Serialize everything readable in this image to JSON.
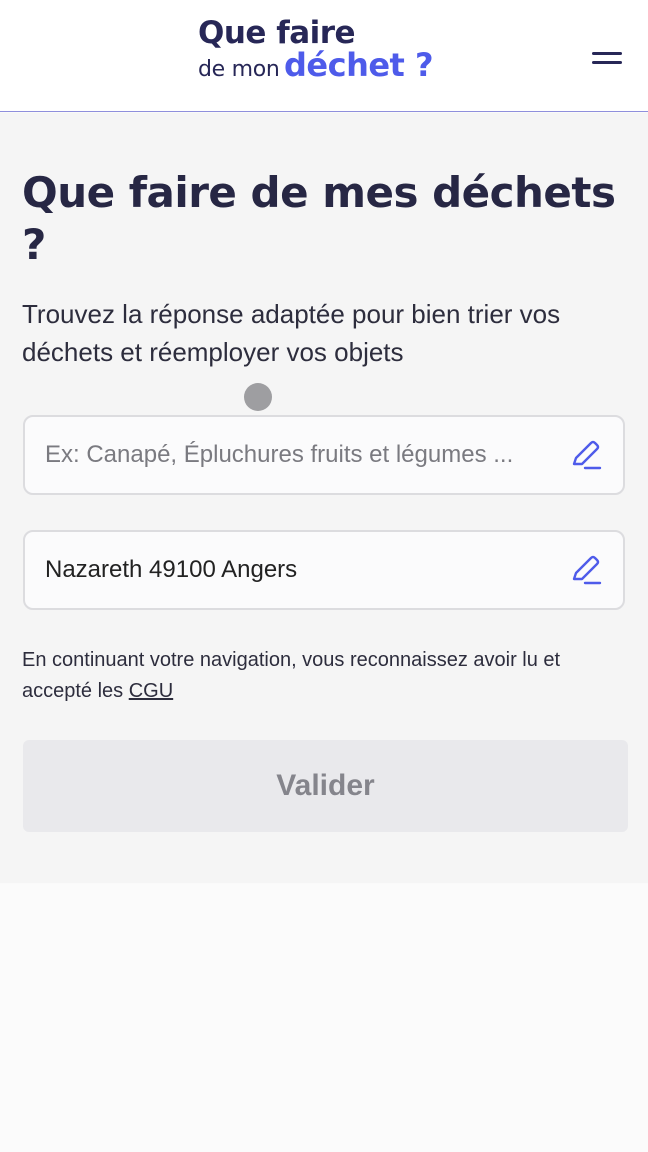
{
  "header": {
    "logo": {
      "line1": "Que faire",
      "line2_prefix": "de mon",
      "line2_accent": "déchet ?"
    },
    "menu_icon": "hamburger-menu-icon"
  },
  "main": {
    "title": "Que faire de mes déchets ?",
    "subtitle": "Trouvez la réponse adaptée pour bien trier vos déchets et réemployer vos objets",
    "search": {
      "placeholder": "Ex: Canapé, Épluchures fruits et légumes ...",
      "value": "",
      "icon": "pencil-icon"
    },
    "location": {
      "value": "Nazareth 49100 Angers",
      "icon": "pencil-icon"
    },
    "notice_text": "En continuant votre navigation, vous reconnaissez avoir lu et accepté les ",
    "notice_link": "CGU",
    "submit_label": "Valider"
  },
  "colors": {
    "brand_dark": "#272757",
    "brand_accent": "#4e5bea",
    "button_disabled_bg": "#e9e9ec",
    "button_disabled_text": "#85858c"
  }
}
